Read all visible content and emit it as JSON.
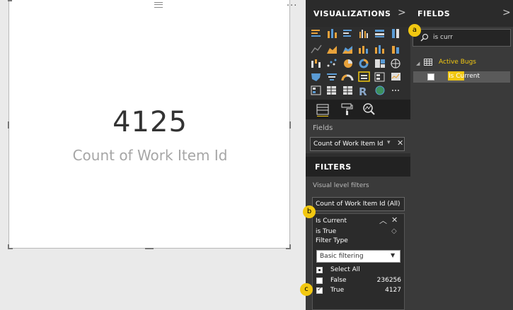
{
  "card": {
    "value": "4125",
    "label": "Count of Work Item Id",
    "more_label": "..."
  },
  "visualizations": {
    "title": "VISUALIZATIONS",
    "chevron": ">",
    "fields_label": "Fields",
    "well_field": "Count of Work Item Id",
    "well_remove": "✕"
  },
  "filters": {
    "title": "FILTERS",
    "level_label": "Visual level filters",
    "card1": "Count of Work Item Id  (All)",
    "card2": {
      "name": "Is Current",
      "state": "is True",
      "filter_type_label": "Filter Type",
      "filter_type_value": "Basic filtering",
      "options": [
        {
          "label": "Select All",
          "count": "",
          "checked": "partial"
        },
        {
          "label": "False",
          "count": "236256",
          "checked": false
        },
        {
          "label": "True",
          "count": "4127",
          "checked": true
        }
      ]
    }
  },
  "fields": {
    "title": "FIELDS",
    "chevron": ">",
    "search_value": "is curr",
    "table": "Active Bugs",
    "field": "Is Current"
  },
  "markers": {
    "a": "a",
    "b": "b",
    "c": "c"
  },
  "colors": {
    "accent": "#f2c811",
    "pane_dark": "#2e2e2e",
    "pane_mid": "#3a3a3a"
  }
}
